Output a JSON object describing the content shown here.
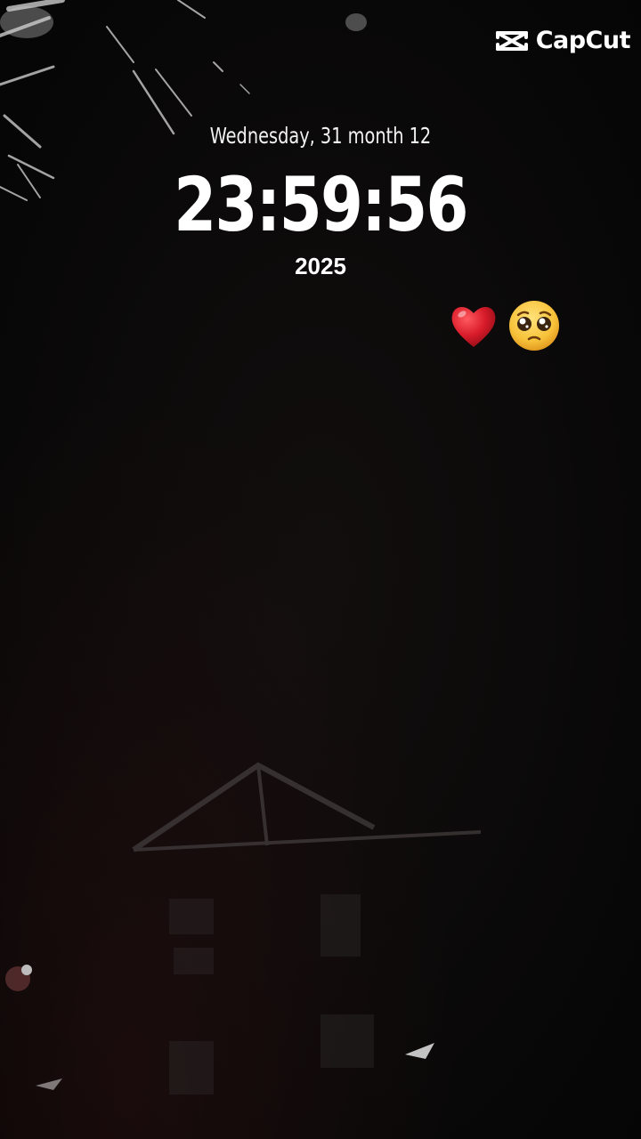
{
  "watermark": {
    "brand": "CapCut"
  },
  "lockscreen": {
    "date": "Wednesday, 31 month 12",
    "time": "23:59:56",
    "year": "2025"
  },
  "emojis": [
    "red-heart",
    "pleading-face"
  ],
  "colors": {
    "background": "#0b0a0a",
    "text": "#ffffff",
    "heart": "#d81b2a",
    "face": "#f7c23a"
  }
}
